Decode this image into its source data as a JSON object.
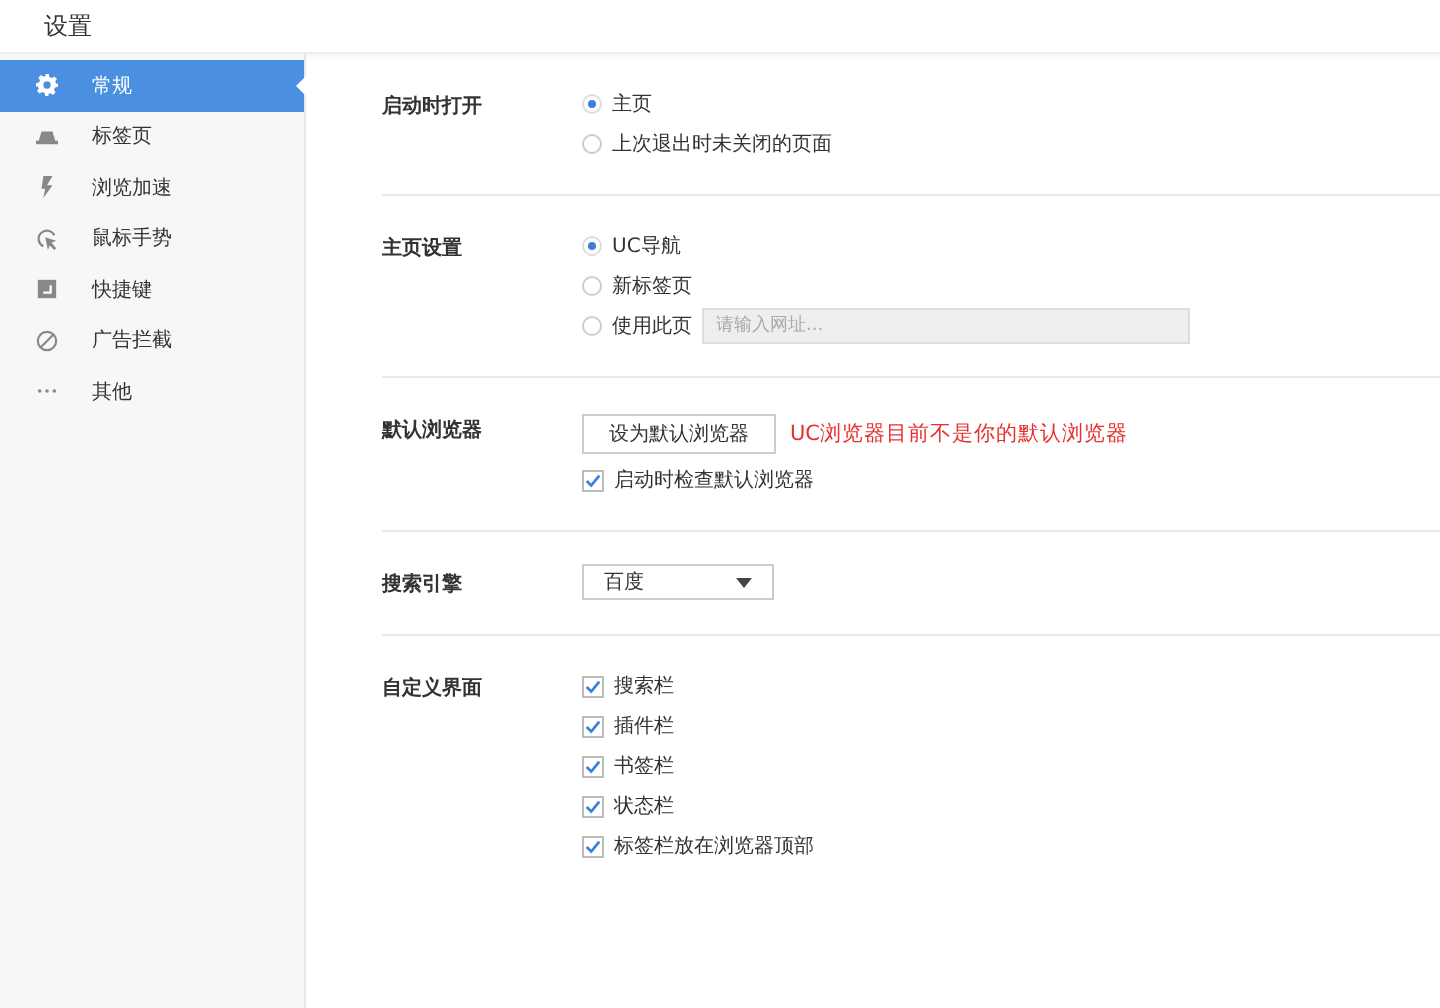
{
  "window": {
    "title": "设置"
  },
  "sidebar": {
    "items": [
      {
        "label": "常规",
        "kind": "gear",
        "selected": true
      },
      {
        "label": "标签页",
        "kind": "tab",
        "selected": false
      },
      {
        "label": "浏览加速",
        "kind": "bolt",
        "selected": false
      },
      {
        "label": "鼠标手势",
        "kind": "cursor",
        "selected": false
      },
      {
        "label": "快捷键",
        "kind": "key",
        "selected": false
      },
      {
        "label": "广告拦截",
        "kind": "block",
        "selected": false
      },
      {
        "label": "其他",
        "kind": "dots",
        "selected": false
      }
    ]
  },
  "sections": [
    {
      "label": "启动时打开",
      "rows": [
        {
          "kind": "radio",
          "label": "主页",
          "selected": true
        },
        {
          "kind": "radio",
          "label": "上次退出时未关闭的页面",
          "selected": false
        }
      ]
    },
    {
      "label": "主页设置",
      "rows": [
        {
          "kind": "radio",
          "label": "UC导航",
          "selected": true
        },
        {
          "kind": "radio",
          "label": "新标签页",
          "selected": false
        },
        {
          "kind": "radio_input",
          "label": "使用此页",
          "selected": false,
          "placeholder": "请输入网址..."
        }
      ]
    },
    {
      "label": "默认浏览器",
      "rows": [
        {
          "kind": "button",
          "label": "设为默认浏览器",
          "note": "UC浏览器目前不是你的默认浏览器"
        },
        {
          "kind": "checkbox",
          "label": "启动时检查默认浏览器",
          "checked": true
        }
      ]
    },
    {
      "label": "搜索引擎",
      "rows": [
        {
          "kind": "select",
          "value": "百度"
        }
      ]
    },
    {
      "label": "自定义界面",
      "rows": [
        {
          "kind": "checkbox",
          "label": "搜索栏",
          "checked": true
        },
        {
          "kind": "checkbox",
          "label": "插件栏",
          "checked": true
        },
        {
          "kind": "checkbox",
          "label": "书签栏",
          "checked": true
        },
        {
          "kind": "checkbox",
          "label": "状态栏",
          "checked": true
        },
        {
          "kind": "checkbox",
          "label": "标签栏放在浏览器顶部",
          "checked": true
        }
      ]
    }
  ]
}
